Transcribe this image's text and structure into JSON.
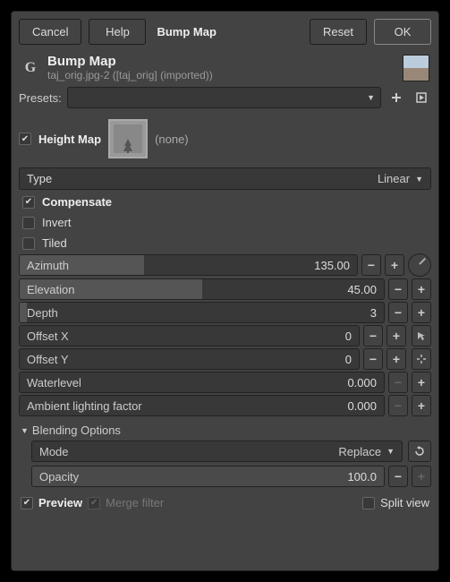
{
  "toolbar": {
    "cancel": "Cancel",
    "help": "Help",
    "title": "Bump Map",
    "reset": "Reset",
    "ok": "OK"
  },
  "header": {
    "title": "Bump Map",
    "subtitle": "taj_orig.jpg-2 ([taj_orig] (imported))"
  },
  "presets": {
    "label": "Presets:"
  },
  "heightmap": {
    "label": "Height Map",
    "value": "(none)"
  },
  "type": {
    "label": "Type",
    "value": "Linear"
  },
  "checks": {
    "compensate": "Compensate",
    "invert": "Invert",
    "tiled": "Tiled"
  },
  "sliders": {
    "azimuth": {
      "label": "Azimuth",
      "value": "135.00",
      "fill": 37
    },
    "elevation": {
      "label": "Elevation",
      "value": "45.00",
      "fill": 50
    },
    "depth": {
      "label": "Depth",
      "value": "3",
      "fill": 2
    },
    "offsetx": {
      "label": "Offset X",
      "value": "0",
      "fill": 0
    },
    "offsety": {
      "label": "Offset Y",
      "value": "0",
      "fill": 0
    },
    "waterlevel": {
      "label": "Waterlevel",
      "value": "0.000",
      "fill": 0
    },
    "ambient": {
      "label": "Ambient lighting factor",
      "value": "0.000",
      "fill": 0
    }
  },
  "blending": {
    "section": "Blending Options",
    "mode_label": "Mode",
    "mode_value": "Replace",
    "opacity_label": "Opacity",
    "opacity_value": "100.0"
  },
  "footer": {
    "preview": "Preview",
    "merge": "Merge filter",
    "split": "Split view"
  }
}
